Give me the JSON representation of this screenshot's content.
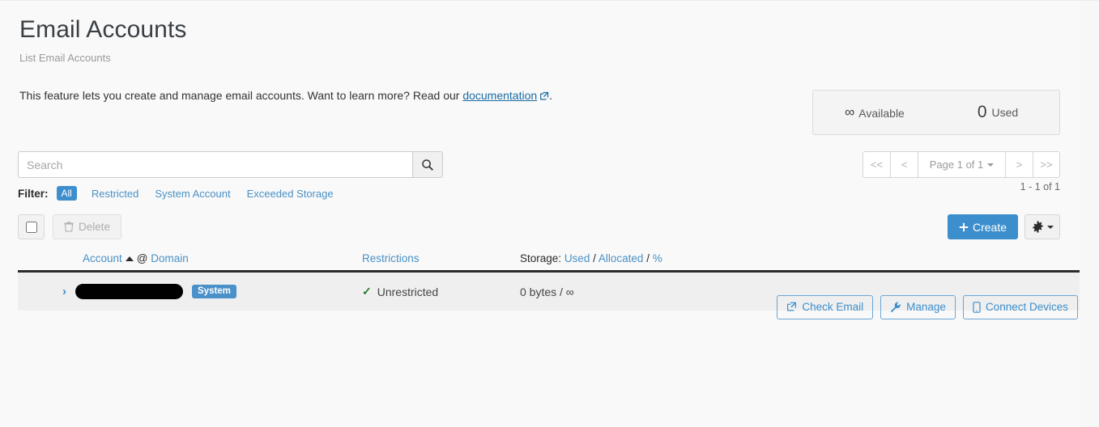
{
  "header": {
    "title": "Email Accounts",
    "subtitle": "List Email Accounts",
    "intro_before": "This feature lets you create and manage email accounts. Want to learn more? Read our ",
    "intro_link": "documentation",
    "intro_after": "."
  },
  "stats": {
    "available_value": "∞",
    "available_label": "Available",
    "used_value": "0",
    "used_label": "Used"
  },
  "search": {
    "placeholder": "Search",
    "value": "",
    "button_icon": "search-icon"
  },
  "filter": {
    "label": "Filter:",
    "items": [
      {
        "label": "All",
        "active": true
      },
      {
        "label": "Restricted",
        "active": false
      },
      {
        "label": "System Account",
        "active": false
      },
      {
        "label": "Exceeded Storage",
        "active": false
      }
    ]
  },
  "pagination": {
    "first": "<<",
    "prev": "<",
    "page_label": "Page 1 of 1",
    "next": ">",
    "last": ">>",
    "count_text": "1 - 1 of 1"
  },
  "toolbar": {
    "select_all_checked": false,
    "delete_label": "Delete",
    "delete_icon": "trash-icon",
    "delete_disabled": true,
    "create_label": "Create",
    "create_icon": "plus-icon",
    "gear_icon": "gear-icon"
  },
  "table": {
    "columns": {
      "account": "Account",
      "at": "@",
      "domain": "Domain",
      "restrictions": "Restrictions",
      "storage_prefix": "Storage:",
      "storage_used": "Used",
      "sep1": "/",
      "storage_allocated": "Allocated",
      "sep2": "/",
      "storage_percent": "%"
    },
    "sort_direction": "ascending",
    "rows": [
      {
        "expand_icon": "chevron-right-icon",
        "account_redacted": true,
        "account_text": "",
        "badge": "System",
        "restriction_icon": "check-icon",
        "restriction": "Unrestricted",
        "storage": "0 bytes / ∞",
        "actions": [
          {
            "label": "Check Email",
            "icon": "external-link-icon"
          },
          {
            "label": "Manage",
            "icon": "wrench-icon"
          },
          {
            "label": "Connect Devices",
            "icon": "mobile-icon"
          }
        ]
      }
    ]
  },
  "colors": {
    "accent": "#3d8ecc",
    "link": "#1a6ca4",
    "badge": "#4a90c9",
    "success": "#2d7a36",
    "page_bg": "#f9f9f9",
    "row_bg": "#efefef"
  }
}
